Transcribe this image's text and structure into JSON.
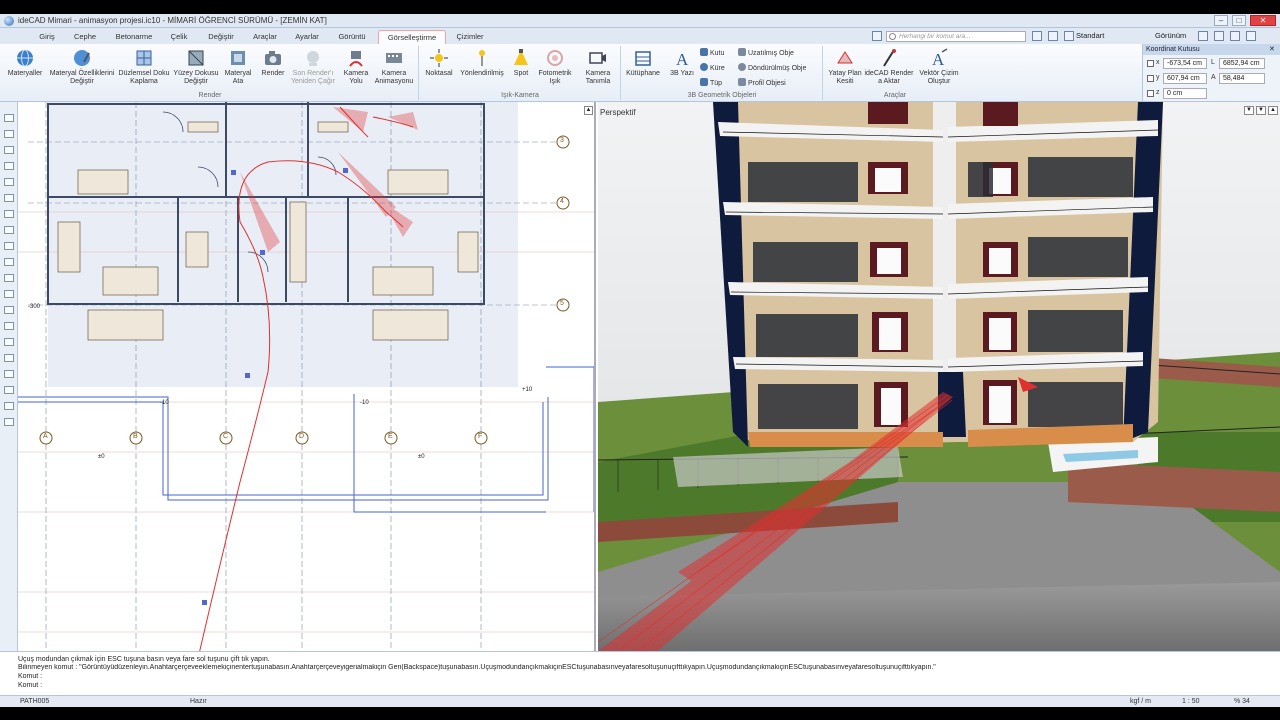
{
  "window": {
    "title": "ideCAD Mimari - animasyon projesi.ic10 - MİMARİ ÖĞRENCİ SÜRÜMÜ - [ZEMİN KAT]"
  },
  "tabs": [
    "Giriş",
    "Cephe",
    "Betonarme",
    "Çelik",
    "Değiştir",
    "Araçlar",
    "Ayarlar",
    "Görüntü",
    "Görselleştirme",
    "Çizimler"
  ],
  "active_tab": "Görselleştirme",
  "search": {
    "placeholder": "Herhangi bir komut ara..."
  },
  "style_select": "Standart",
  "view_menu": "Görünüm",
  "ribbon": {
    "render_group": {
      "label": "Render",
      "buttons": [
        {
          "label": "Materyaller",
          "icon": "globe-icon"
        },
        {
          "label": "Materyal Özelliklerini Değiştir",
          "icon": "material-edit-icon"
        },
        {
          "label": "Düzlemsel Doku Kaplama",
          "icon": "planar-texture-icon"
        },
        {
          "label": "Yüzey Dokusu Değiştir",
          "icon": "surface-texture-icon"
        },
        {
          "label": "Materyal Ata",
          "icon": "assign-material-icon"
        },
        {
          "label": "Render",
          "icon": "camera-icon"
        },
        {
          "label": "Son Render'ı Yeniden Çağır",
          "icon": "recall-render-icon"
        },
        {
          "label": "Kamera Yolu",
          "icon": "camera-path-icon"
        },
        {
          "label": "Kamera Animasyonu",
          "icon": "camera-animation-icon"
        }
      ]
    },
    "light_group": {
      "label": "Işık-Kamera",
      "buttons": [
        {
          "label": "Noktasal",
          "icon": "point-light-icon"
        },
        {
          "label": "Yönlendirilmiş",
          "icon": "directional-light-icon"
        },
        {
          "label": "Spot",
          "icon": "spot-light-icon"
        },
        {
          "label": "Fotometrik Işık",
          "icon": "photometric-light-icon"
        },
        {
          "label": "Kamera Tanımla",
          "icon": "define-camera-icon"
        }
      ]
    },
    "geo_group": {
      "label": "3B Geometrik Objeleri",
      "library": "Kütüphane",
      "text3d": "3B Yazı",
      "small": [
        "Kutu",
        "Küre",
        "Tüp"
      ],
      "small2": [
        "Uzatılmış Obje",
        "Döndürülmüş Obje",
        "Profil Objesi"
      ]
    },
    "tools_group": {
      "label": "Araçlar",
      "buttons": [
        {
          "label": "Yatay Plan Kesiti",
          "icon": "plan-section-icon"
        },
        {
          "label": "ideCAD Render a Aktar",
          "icon": "export-render-icon"
        },
        {
          "label": "Vektör Çizim Oluştur",
          "icon": "vector-drawing-icon"
        }
      ]
    }
  },
  "coord_box": {
    "title": "Koordinat Kutusu",
    "x": "-673,54 cm",
    "y": "607,94 cm",
    "z": "0 cm",
    "l_label": "L",
    "l": "6852,94 cm",
    "a_label": "A",
    "a": "58,484"
  },
  "plan_view": {
    "axis_cols": [
      "A",
      "B",
      "C",
      "D",
      "E",
      "F"
    ],
    "axis_rows": [
      "3",
      "4",
      "5"
    ],
    "dims": [
      "±0",
      "-10",
      "±0",
      "-300",
      "-10",
      "+10"
    ]
  },
  "perspective_view": {
    "label": "Perspektif"
  },
  "command_lines": [
    "Uçuş modundan çıkmak için ESC tuşuna basın veya fare sol tuşunu çift tık yapın.",
    "Bilinmeyen komut : \"Görüntüyüdüzenleyin.Anahtarçerçeveeklemekiçinentertuşunabasın.Anahtarçerçeveyigerialmakiçin Geri(Backspace)tuşunabasın.UçuşmodundançıkmakiçinESCtuşunabasınveyafaresoltuşunuçifttıkyapın.UçuşmodundançıkmakiçinESCtuşunabasınveyafaresoltuşunuçifttıkyapın.\"",
    "Komut :",
    "Komut :"
  ],
  "status": {
    "left": "PATH005",
    "mode": "Hazır",
    "unit": "kgf / m",
    "scale": "1 : 50",
    "zoom": "% 34"
  }
}
